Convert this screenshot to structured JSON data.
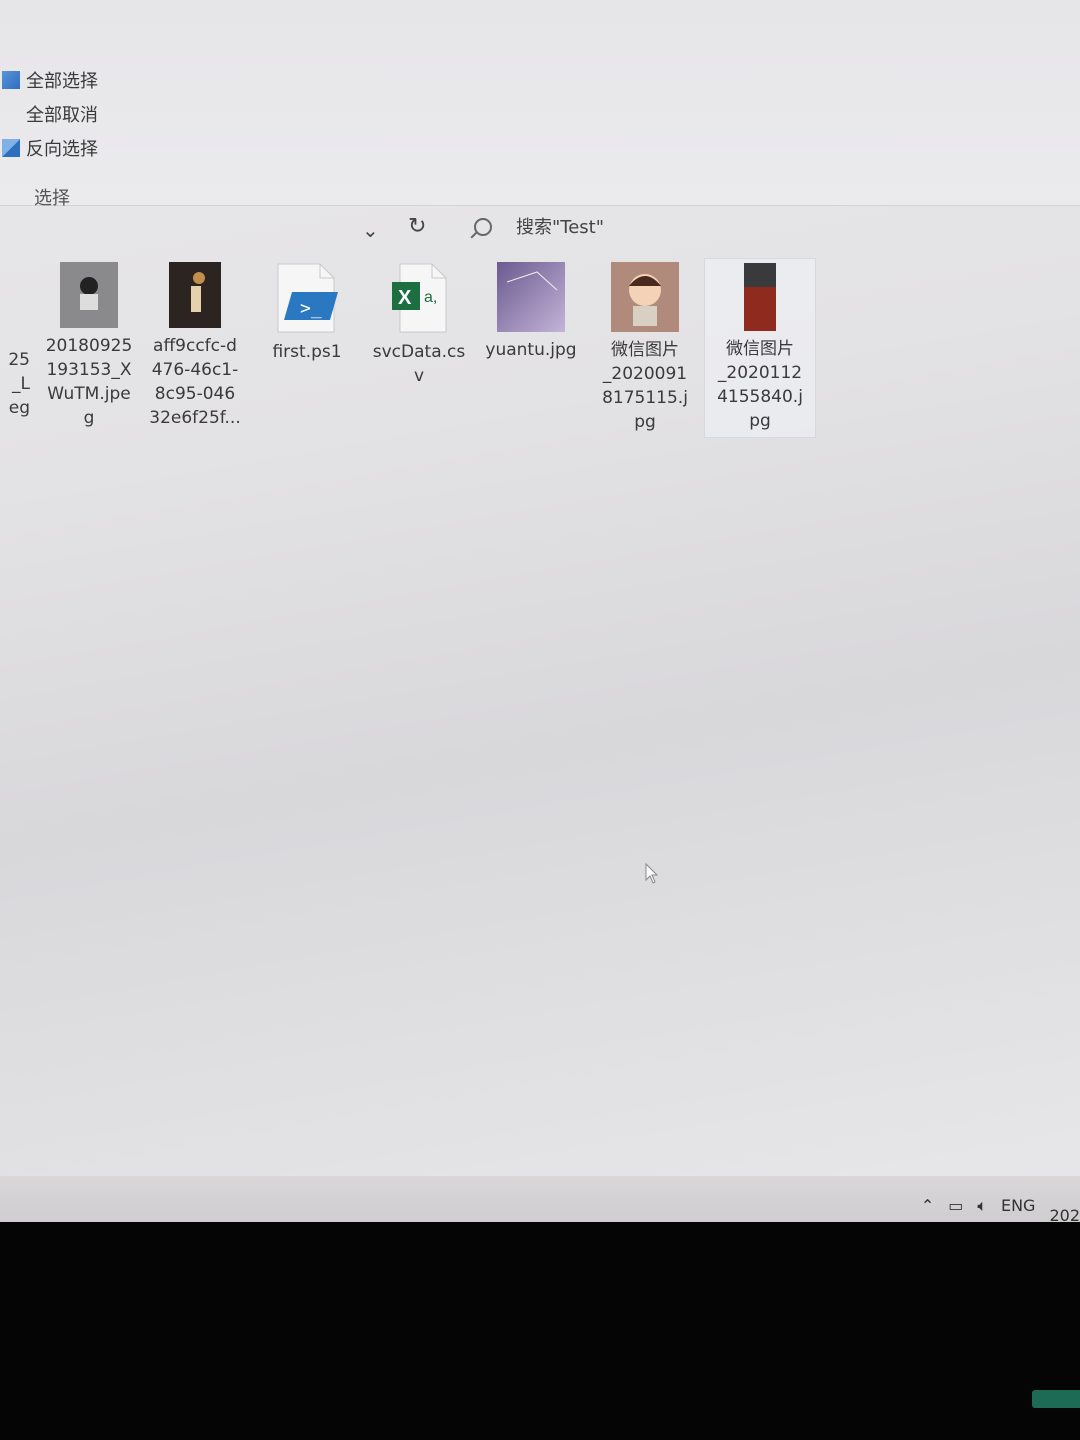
{
  "ribbon": {
    "select_all": "全部选择",
    "select_none": "全部取消",
    "invert_selection": "反向选择",
    "group_label": "选择"
  },
  "nav": {
    "search_placeholder": "搜索\"Test\""
  },
  "files": [
    {
      "name": "25\n_L\neg",
      "type": "image"
    },
    {
      "name": "20180925\n193153_X\nWuTM.jpe\ng",
      "type": "image"
    },
    {
      "name": "aff9ccfc-d\n476-46c1-\n8c95-046\n32e6f25f...",
      "type": "image"
    },
    {
      "name": "first.ps1",
      "type": "powershell"
    },
    {
      "name": "svcData.cs\nv",
      "type": "excel-csv"
    },
    {
      "name": "yuantu.jpg",
      "type": "image"
    },
    {
      "name": "微信图片\n_2020091\n8175115.j\npg",
      "type": "image"
    },
    {
      "name": "微信图片\n_2020112\n4155840.j\npg",
      "type": "image"
    }
  ],
  "tray": {
    "language": "ENG",
    "clock_partial": "202"
  },
  "colors": {
    "excel_green": "#1d6f42",
    "powershell_blue": "#2a78c2"
  }
}
